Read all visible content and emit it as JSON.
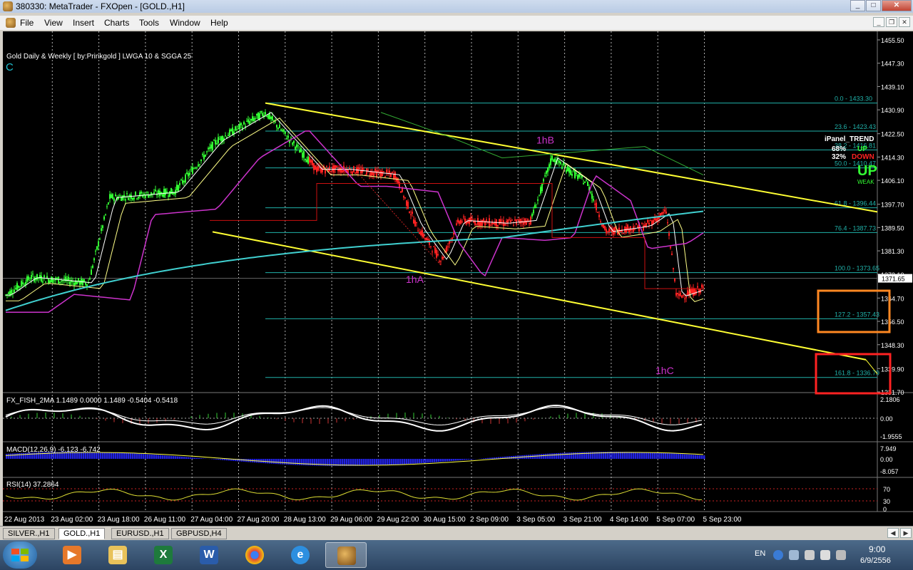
{
  "window": {
    "title": "380330: MetaTrader - FXOpen - [GOLD.,H1]"
  },
  "menu": [
    "File",
    "View",
    "Insert",
    "Charts",
    "Tools",
    "Window",
    "Help"
  ],
  "chart": {
    "header": "Gold Daily & Weekly  [ by:Prinkgold ]  LWGA 10  &  SGGA 25",
    "corner_label": "C",
    "panels": {
      "fisher": "FX_FISH_2MA 1.1489 0.0000 1.1489 -0.5404 -0.5418",
      "macd": "MACD(12,26,9) -6.123 -6.742",
      "rsi": "RSI(14) 37.2864"
    },
    "price_axis": [
      "1455.50",
      "1447.30",
      "1439.10",
      "1430.90",
      "1422.50",
      "1414.30",
      "1406.10",
      "1397.70",
      "1389.50",
      "1381.30",
      "1373.10",
      "1364.70",
      "1356.50",
      "1348.30",
      "1339.90",
      "1331.70"
    ],
    "current_price": "1371.65",
    "fisher_axis": [
      "2.1806",
      "0.00",
      "-1.9555"
    ],
    "macd_axis": [
      "7.949",
      "0.00",
      "-8.057"
    ],
    "rsi_axis": [
      "70",
      "30",
      "0"
    ],
    "time_axis": [
      "22 Aug 2013",
      "23 Aug 02:00",
      "23 Aug 18:00",
      "26 Aug 11:00",
      "27 Aug 04:00",
      "27 Aug 20:00",
      "28 Aug 13:00",
      "29 Aug 06:00",
      "29 Aug 22:00",
      "30 Aug 15:00",
      "2 Sep 09:00",
      "3 Sep 05:00",
      "3 Sep 21:00",
      "4 Sep 14:00",
      "5 Sep 07:00",
      "5 Sep 23:00"
    ],
    "fib_levels": [
      "0.0 - 1433.30",
      "23.6 - 1423.43",
      "38.2 - 1416.81",
      "50.0 - 1410.47",
      "61.8 - 1396.44",
      "76.4 - 1387.73",
      "100.0 - 1373.65",
      "127.2 - 1357.43",
      "161.8 - 1336.79"
    ],
    "wave_labels": [
      "1hA",
      "1hB",
      "1hC"
    ],
    "ipanel": {
      "title": "iPanel_TREND",
      "pct_up": "68%",
      "pct_down": "32%",
      "up": "UP",
      "down": "DOWN",
      "big": "UP",
      "weak": "WEAK"
    },
    "colors": {
      "bull": "#33ff33",
      "bear": "#ff2222",
      "fib": "#20b2aa",
      "channel": "#ffff33",
      "wave": "#cc33cc",
      "orange_box": "#ff8822",
      "red_box": "#ff2222"
    }
  },
  "tabs": [
    "SILVER.,H1",
    "GOLD.,H1",
    "EURUSD.,H1",
    "GBPUSD,H4"
  ],
  "active_tab": "GOLD.,H1",
  "taskbar": {
    "apps": [
      "media-player",
      "file-explorer",
      "excel",
      "word",
      "chrome",
      "internet-explorer",
      "metatrader"
    ],
    "lang": "EN",
    "time": "9:00",
    "date": "6/9/2556"
  }
}
